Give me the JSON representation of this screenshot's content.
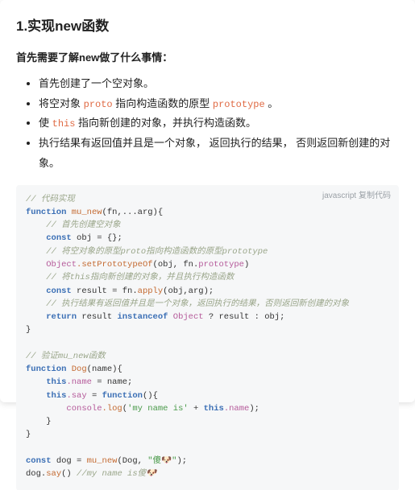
{
  "title": "1.实现new函数",
  "intro": "首先需要了解new做了什么事情：",
  "bullets": [
    {
      "pre": "首先创建了一个空对象。",
      "code": "",
      "post": ""
    },
    {
      "pre": "将空对象 ",
      "code": "proto",
      "mid": " 指向构造函数的原型 ",
      "code2": "prototype",
      "post": " 。"
    },
    {
      "pre": "使 ",
      "code": "this",
      "mid": " 指向新创建的对象，并执行构造函数。",
      "code2": "",
      "post": ""
    },
    {
      "pre": "执行结果有返回值并且是一个对象， 返回执行的结果， 否则返回新创建的对象。",
      "code": "",
      "post": ""
    }
  ],
  "codeHeader": {
    "lang": "javascript",
    "copy": "复制代码"
  },
  "code": {
    "c1": "// 代码实现",
    "l1_kw": "function",
    "l1_fn": "mu_new",
    "l1_rest": "(fn,...arg){",
    "c2": "// 首先创建空对象",
    "l2_kw": "const",
    "l2_rest": " obj = {};",
    "c3": "// 将空对象的原型proto指向构造函数的原型prototype",
    "l3_obj": "Object",
    "l3_m": ".setPrototypeOf",
    "l3_r": "(obj, fn.",
    "l3_p": "prototype",
    "l3_e": ")",
    "c4": "// 将this指向新创建的对象，并且执行构造函数",
    "l4_kw": "const",
    "l4_r1": " result = fn.",
    "l4_m": "apply",
    "l4_r2": "(obj,arg);",
    "c5": "// 执行结果有返回值并且是一个对象，返回执行的结果，否则返回新创建的对象",
    "l5_kw": "return",
    "l5_r1": " result ",
    "l5_kw2": "instanceof",
    "l5_r2": " ",
    "l5_obj": "Object",
    "l5_r3": " ? result : obj;",
    "close1": "}",
    "c6": "// 验证mu_new函数",
    "l6_kw": "function",
    "l6_fn": "Dog",
    "l6_r": "(name){",
    "l7_kw": "this",
    "l7_p": ".name",
    "l7_r": " = name;",
    "l8_kw": "this",
    "l8_p": ".say",
    "l8_r1": " = ",
    "l8_kw2": "function",
    "l8_r2": "(){",
    "l9_obj": "console",
    "l9_m": ".log",
    "l9_r1": "(",
    "l9_s": "'my name is'",
    "l9_r2": " + ",
    "l9_kw": "this",
    "l9_p": ".name",
    "l9_r3": ");",
    "close2": "}",
    "close3": "}",
    "l10_kw": "const",
    "l10_r1": " dog = ",
    "l10_fn": "mu_new",
    "l10_r2": "(Dog, ",
    "l10_s": "\"傻🐶\"",
    "l10_r3": ");",
    "l11_r1": "dog.",
    "l11_m": "say",
    "l11_r2": "() ",
    "l11_c": "//my name is傻🐶"
  }
}
